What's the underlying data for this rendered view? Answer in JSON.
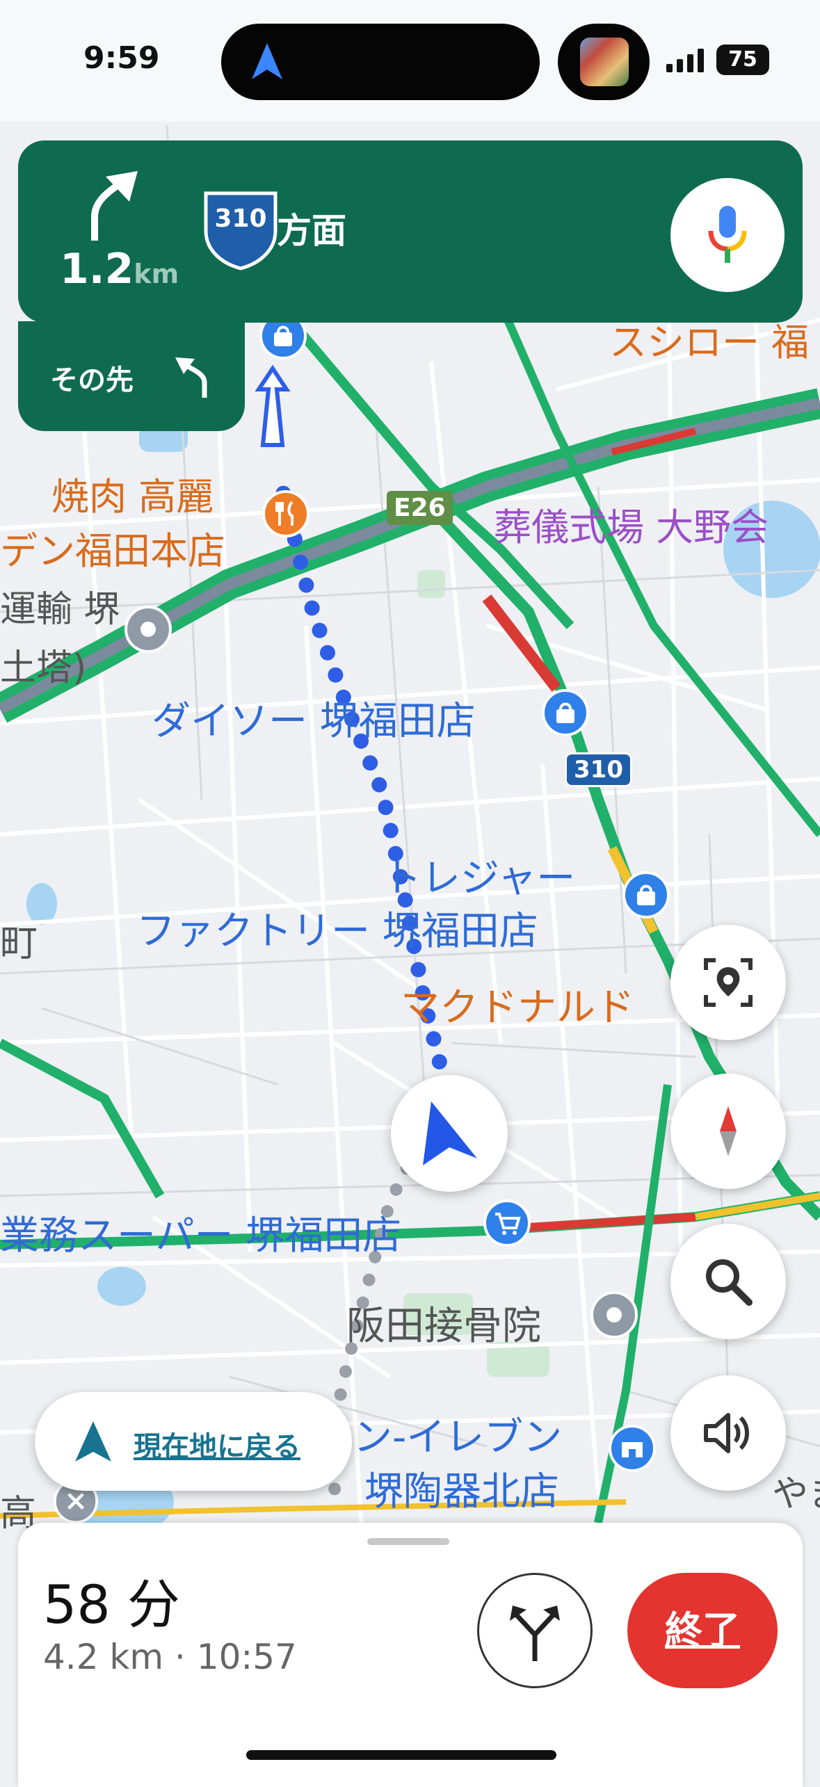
{
  "status_bar": {
    "time": "9:59",
    "battery": "75"
  },
  "navigation": {
    "distance_value": "1.2",
    "distance_unit": "km",
    "route_shield": "310",
    "direction_text": "方面",
    "then_label": "その先",
    "turn_icon": "turn-slight-right-icon",
    "then_icon": "turn-slight-left-icon"
  },
  "map_labels": {
    "yakiniku_line1": "焼肉 高麗",
    "yakiniku_line2": "デン福田本店",
    "funeral": "葬儀式場 大野会",
    "unyu_line1": "運輸 堺",
    "unyu_line2": "土塔)",
    "daiso": "ダイソー 堺福田店",
    "treasure_line1": "トレジャー",
    "treasure_line2": "ファクトリー 堺福田店",
    "mcdonalds": "マクドナルド",
    "gyomu": "業務スーパー 堺福田店",
    "sakata": "阪田接骨院",
    "seven_line1": "ン-イレブン",
    "seven_line2": "堺陶器北店",
    "sushiro": "スシロー 福",
    "machi": "町",
    "taka": "高",
    "yama": "やま",
    "highway_label": "E26",
    "route_badge": "310"
  },
  "controls": {
    "recenter_label": "現在地に戻る",
    "fab_icons": [
      "visual-search-icon",
      "compass-icon",
      "search-icon",
      "volume-icon"
    ]
  },
  "trip": {
    "eta_minutes": "58 分",
    "distance_and_arrival": "4.2 km · 10:57",
    "end_label": "終了"
  },
  "colors": {
    "nav_green": "#0f6b4f",
    "route_blue": "#2f5ee6",
    "road_green": "#21b06a",
    "end_red": "#e3342f",
    "link_teal": "#17738f"
  }
}
